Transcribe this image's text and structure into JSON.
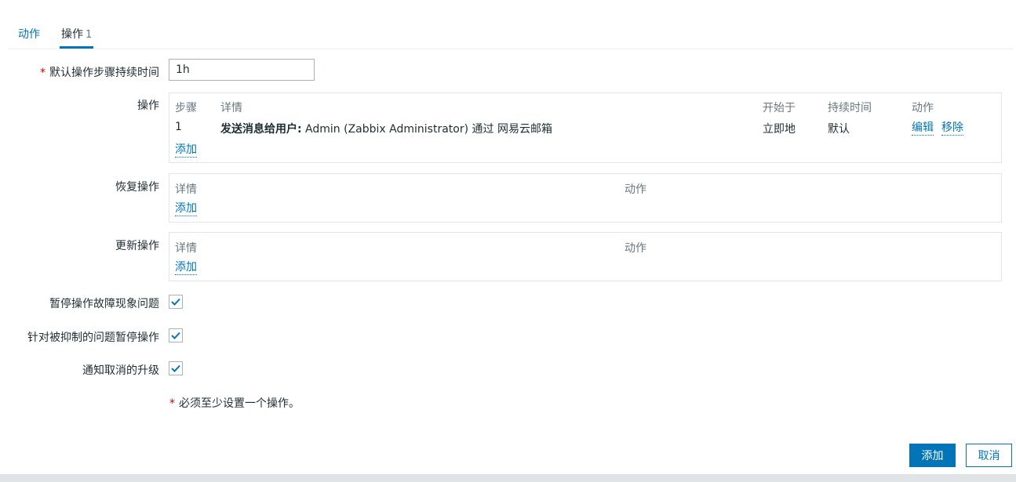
{
  "tabs": {
    "actions_label": "动作",
    "operations_label": "操作",
    "operations_count": "1"
  },
  "form": {
    "required_mark": "*",
    "default_step_duration": {
      "label": "默认操作步骤持续时间",
      "value": "1h"
    },
    "operations": {
      "label": "操作",
      "headers": {
        "step": "步骤",
        "details": "详情",
        "start_in": "开始于",
        "duration": "持续时间",
        "action": "动作"
      },
      "rows": [
        {
          "step": "1",
          "details_bold": "发送消息给用户:",
          "details_rest": " Admin (Zabbix Administrator) 通过 网易云邮箱",
          "start_in": "立即地",
          "duration": "默认",
          "edit": "编辑",
          "remove": "移除"
        }
      ],
      "add": "添加"
    },
    "recovery_operations": {
      "label": "恢复操作",
      "headers": {
        "details": "详情",
        "action": "动作"
      },
      "add": "添加"
    },
    "update_operations": {
      "label": "更新操作",
      "headers": {
        "details": "详情",
        "action": "动作"
      },
      "add": "添加"
    },
    "pause_symptoms": {
      "label": "暂停操作故障现象问题",
      "checked": true
    },
    "pause_suppressed": {
      "label": "针对被抑制的问题暂停操作",
      "checked": true
    },
    "notify_canceled": {
      "label": "通知取消的升级",
      "checked": true
    },
    "note": "必须至少设置一个操作。"
  },
  "buttons": {
    "add": "添加",
    "cancel": "取消"
  },
  "colors": {
    "accent": "#0275b8",
    "required": "#d40000",
    "muted": "#687780"
  },
  "icons": {
    "checkbox": "checkmark-icon"
  }
}
